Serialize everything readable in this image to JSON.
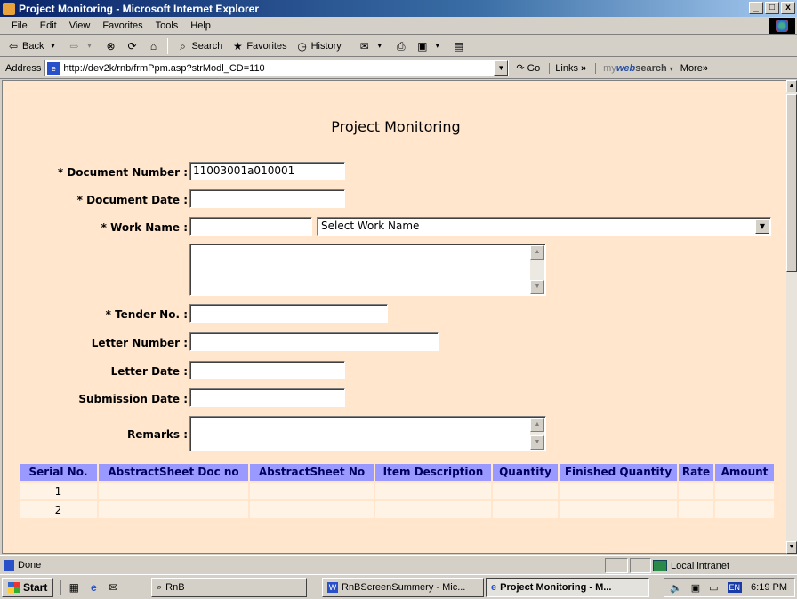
{
  "window": {
    "title": "Project Monitoring - Microsoft Internet Explorer",
    "buttons": [
      "_",
      "□",
      "x"
    ]
  },
  "menu": [
    "File",
    "Edit",
    "View",
    "Favorites",
    "Tools",
    "Help"
  ],
  "toolbar": {
    "back": "Back",
    "search": "Search",
    "favorites": "Favorites",
    "history": "History"
  },
  "address": {
    "label": "Address",
    "url": "http://dev2k/rnb/frmPpm.asp?strModl_CD=110",
    "go": "Go",
    "links": "Links",
    "mywebsearch": {
      "prefix": "my",
      "brand": "web",
      "suffix": "search"
    },
    "more": "More"
  },
  "page": {
    "title": "Project Monitoring",
    "fields": {
      "document_number": {
        "label": "* Document Number :",
        "value": "11003001a010001"
      },
      "document_date": {
        "label": "* Document Date :",
        "value": ""
      },
      "work_name": {
        "label": "* Work Name :",
        "value": "",
        "select_value": "Select Work Name"
      },
      "tender_no": {
        "label": "* Tender No. :",
        "value": ""
      },
      "letter_number": {
        "label": "Letter Number :",
        "value": ""
      },
      "letter_date": {
        "label": "Letter Date :",
        "value": ""
      },
      "submission_date": {
        "label": "Submission Date :",
        "value": ""
      },
      "remarks": {
        "label": "Remarks :",
        "value": ""
      }
    },
    "grid": {
      "columns": [
        "Serial No.",
        "AbstractSheet Doc no",
        "AbstractSheet No",
        "Item Description",
        "Quantity",
        "Finished Quantity",
        "Rate",
        "Amount"
      ],
      "rows": [
        [
          "1",
          "",
          "",
          "",
          "",
          "",
          "",
          ""
        ],
        [
          "2",
          "",
          "",
          "",
          "",
          "",
          "",
          ""
        ]
      ]
    }
  },
  "status": {
    "text": "Done",
    "zone": "Local intranet"
  },
  "taskbar": {
    "start": "Start",
    "tasks": [
      {
        "label": "RnB",
        "active": false
      },
      {
        "label": "RnBScreenSummery - Mic...",
        "active": false
      },
      {
        "label": "Project Monitoring - M...",
        "active": true
      }
    ],
    "lang": "EN",
    "clock": "6:19 PM"
  }
}
